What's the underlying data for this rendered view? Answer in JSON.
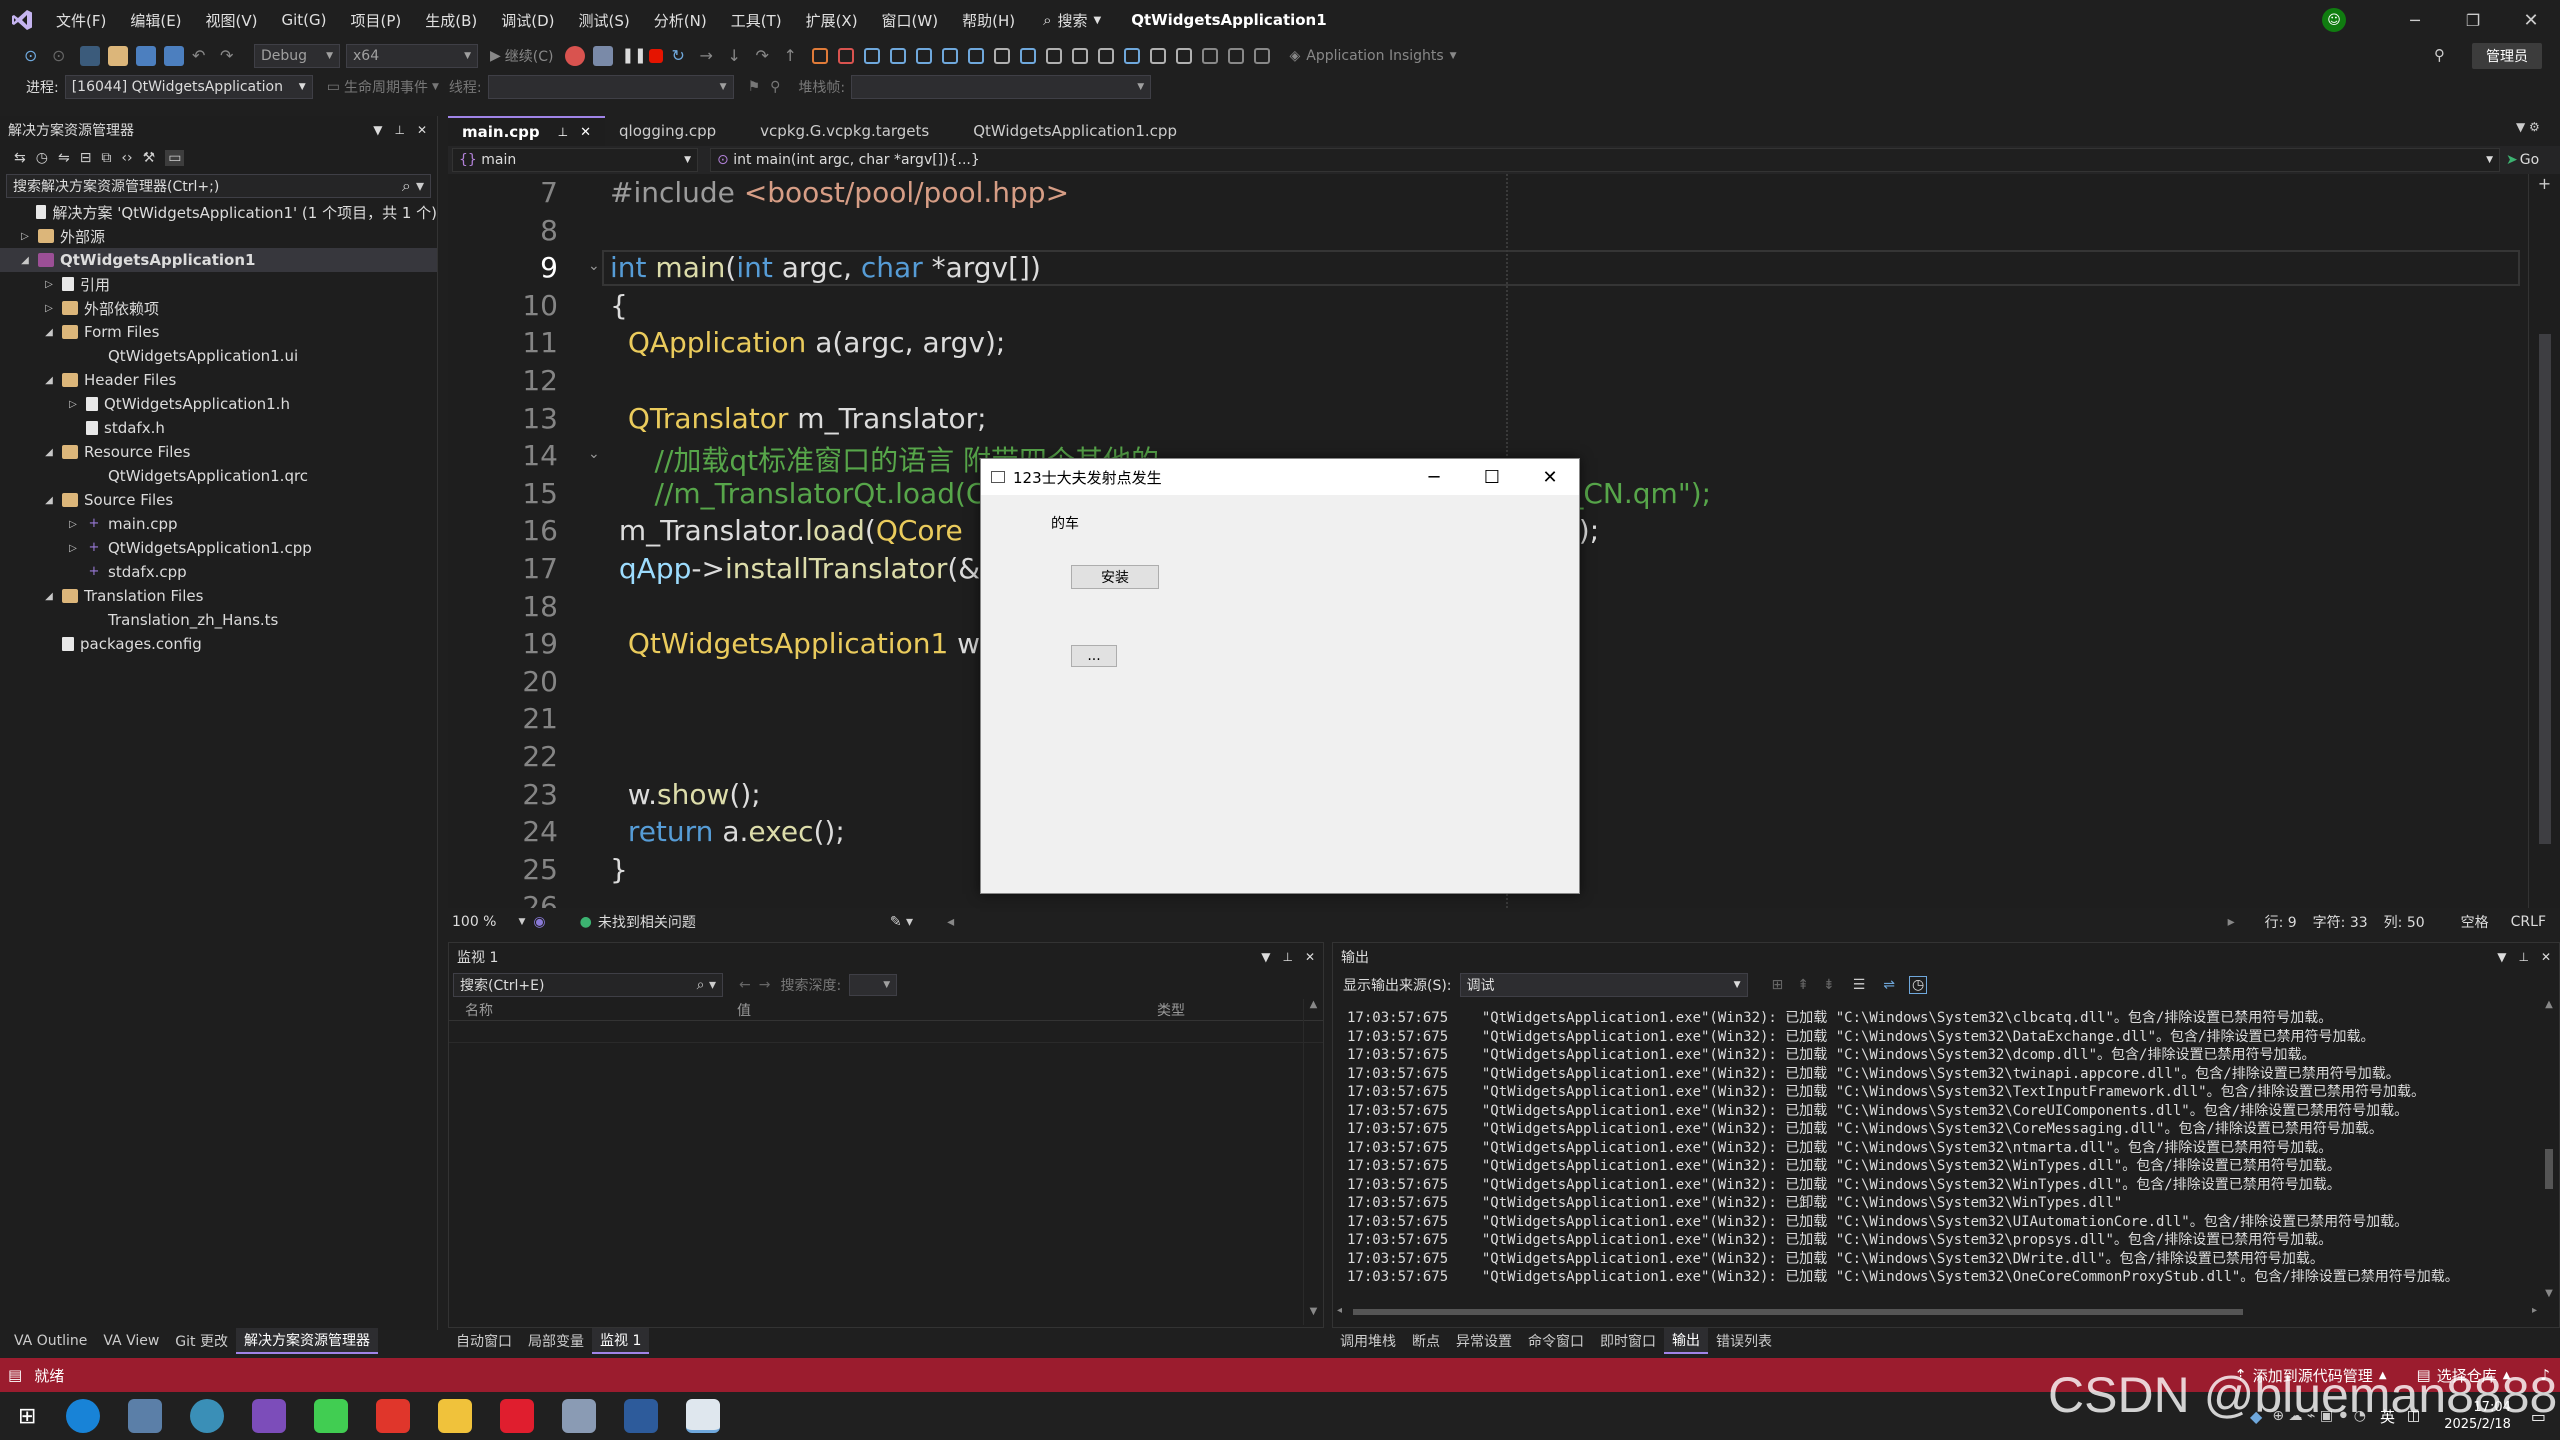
{
  "titlebar": {
    "menus": [
      "文件(F)",
      "编辑(E)",
      "视图(V)",
      "Git(G)",
      "项目(P)",
      "生成(B)",
      "调试(D)",
      "测试(S)",
      "分析(N)",
      "工具(T)",
      "扩展(X)",
      "窗口(W)",
      "帮助(H)"
    ],
    "search_label": "搜索",
    "app_title": "QtWidgetsApplication1",
    "admin_label": "管理员"
  },
  "toolbar": {
    "config": "Debug",
    "platform": "x64",
    "continue_label": "继续(C)",
    "app_insights": "Application Insights"
  },
  "toolbar2": {
    "process_label": "进程:",
    "process_value": "[16044] QtWidgetsApplication",
    "lifecycle_label": "生命周期事件",
    "thread_label": "线程:",
    "stackframe_label": "堆栈帧:"
  },
  "solution": {
    "title": "解决方案资源管理器",
    "search_placeholder": "搜索解决方案资源管理器(Ctrl+;)",
    "items": [
      {
        "label": "解决方案 'QtWidgetsApplication1' (1 个项目，共 1 个)",
        "indent": 0,
        "icon": "doc",
        "tw": ""
      },
      {
        "label": "外部源",
        "indent": 0,
        "icon": "folder",
        "tw": "▷"
      },
      {
        "label": "QtWidgetsApplication1",
        "indent": 0,
        "icon": "proj",
        "tw": "◢",
        "sel": true
      },
      {
        "label": "引用",
        "indent": 1,
        "icon": "doc",
        "tw": "▷"
      },
      {
        "label": "外部依赖项",
        "indent": 1,
        "icon": "folder",
        "tw": "▷"
      },
      {
        "label": "Form Files",
        "indent": 1,
        "icon": "folder",
        "tw": "◢"
      },
      {
        "label": "QtWidgetsApplication1.ui",
        "indent": 2,
        "icon": "none",
        "tw": ""
      },
      {
        "label": "Header Files",
        "indent": 1,
        "icon": "folder",
        "tw": "◢"
      },
      {
        "label": "QtWidgetsApplication1.h",
        "indent": 2,
        "icon": "doc",
        "tw": "▷"
      },
      {
        "label": "stdafx.h",
        "indent": 2,
        "icon": "doc",
        "tw": ""
      },
      {
        "label": "Resource Files",
        "indent": 1,
        "icon": "folder",
        "tw": "◢"
      },
      {
        "label": "QtWidgetsApplication1.qrc",
        "indent": 2,
        "icon": "none",
        "tw": ""
      },
      {
        "label": "Source Files",
        "indent": 1,
        "icon": "folder",
        "tw": "◢"
      },
      {
        "label": "main.cpp",
        "indent": 2,
        "icon": "cpp",
        "tw": "▷"
      },
      {
        "label": "QtWidgetsApplication1.cpp",
        "indent": 2,
        "icon": "cpp",
        "tw": "▷"
      },
      {
        "label": "stdafx.cpp",
        "indent": 2,
        "icon": "cpp",
        "tw": ""
      },
      {
        "label": "Translation Files",
        "indent": 1,
        "icon": "folder",
        "tw": "◢"
      },
      {
        "label": "Translation_zh_Hans.ts",
        "indent": 2,
        "icon": "none",
        "tw": ""
      },
      {
        "label": "packages.config",
        "indent": 1,
        "icon": "doc",
        "tw": ""
      }
    ]
  },
  "editor_tabs": [
    "main.cpp",
    "qlogging.cpp",
    "vcpkg.G.vcpkg.targets",
    "QtWidgetsApplication1.cpp"
  ],
  "navbar": {
    "scope": "main",
    "member": "int main(int argc, char *argv[]){...}",
    "go": "Go"
  },
  "code_lines": [
    {
      "n": "7",
      "html": "<span class='pp'>#include </span><span class='str'>&lt;boost/pool/pool.hpp&gt;</span>"
    },
    {
      "n": "8",
      "html": ""
    },
    {
      "n": "9",
      "html": "<span class='kw'>int</span> <span class='fn'>main</span>(<span class='kw'>int</span> argc, <span class='kw'>char</span> *argv[])"
    },
    {
      "n": "10",
      "html": "{"
    },
    {
      "n": "11",
      "html": "  <span class='cls'>QApplication</span> a(argc, argv);"
    },
    {
      "n": "12",
      "html": ""
    },
    {
      "n": "13",
      "html": "  <span class='cls'>QTranslator</span> m_Translator;"
    },
    {
      "n": "14",
      "html": "     <span class='cm'>//加载qt标准窗口的语言 附带四个其他的</span>"
    },
    {
      "n": "15",
      "html": "     <span class='cm'>//m_TranslatorQt.load(C                                          nslations/qt_zh_CN.qm\");</span>"
    },
    {
      "n": "16",
      "html": " m_Translator.<span class='fn'>load</span>(<span class='cls'>QCore</span>                                             <span class='str'>n_zh_Hans.qm\"</span>);"
    },
    {
      "n": "17",
      "html": " <span class='var'>qApp</span>-&gt;<span class='fn'>installTranslator</span>(&amp;"
    },
    {
      "n": "18",
      "html": ""
    },
    {
      "n": "19",
      "html": "  <span class='cls'>QtWidgetsApplication1</span> w"
    },
    {
      "n": "20",
      "html": ""
    },
    {
      "n": "21",
      "html": ""
    },
    {
      "n": "22",
      "html": ""
    },
    {
      "n": "23",
      "html": "  w.<span class='fn'>show</span>();"
    },
    {
      "n": "24",
      "html": "  <span class='kw'>return</span> a.<span class='fn'>exec</span>();"
    },
    {
      "n": "25",
      "html": "}"
    },
    {
      "n": "26",
      "html": ""
    }
  ],
  "statusline": {
    "zoom": "100 %",
    "issues": "未找到相关问题",
    "line": "行: 9",
    "char": "字符: 33",
    "col": "列: 50",
    "space": "空格",
    "eol": "CRLF"
  },
  "watch": {
    "title": "监视 1",
    "search_placeholder": "搜索(Ctrl+E)",
    "depth_label": "搜索深度:",
    "col_name": "名称",
    "col_value": "值",
    "col_type": "类型"
  },
  "output": {
    "title": "输出",
    "source_label": "显示输出来源(S):",
    "source_value": "调试",
    "lines": [
      "17:03:57:675    \"QtWidgetsApplication1.exe\"(Win32): 已加载 \"C:\\Windows\\System32\\clbcatq.dll\"。包含/排除设置已禁用符号加载。",
      "17:03:57:675    \"QtWidgetsApplication1.exe\"(Win32): 已加载 \"C:\\Windows\\System32\\DataExchange.dll\"。包含/排除设置已禁用符号加载。",
      "17:03:57:675    \"QtWidgetsApplication1.exe\"(Win32): 已加载 \"C:\\Windows\\System32\\dcomp.dll\"。包含/排除设置已禁用符号加载。",
      "17:03:57:675    \"QtWidgetsApplication1.exe\"(Win32): 已加载 \"C:\\Windows\\System32\\twinapi.appcore.dll\"。包含/排除设置已禁用符号加载。",
      "17:03:57:675    \"QtWidgetsApplication1.exe\"(Win32): 已加载 \"C:\\Windows\\System32\\TextInputFramework.dll\"。包含/排除设置已禁用符号加载。",
      "17:03:57:675    \"QtWidgetsApplication1.exe\"(Win32): 已加载 \"C:\\Windows\\System32\\CoreUIComponents.dll\"。包含/排除设置已禁用符号加载。",
      "17:03:57:675    \"QtWidgetsApplication1.exe\"(Win32): 已加载 \"C:\\Windows\\System32\\CoreMessaging.dll\"。包含/排除设置已禁用符号加载。",
      "17:03:57:675    \"QtWidgetsApplication1.exe\"(Win32): 已加载 \"C:\\Windows\\System32\\ntmarta.dll\"。包含/排除设置已禁用符号加载。",
      "17:03:57:675    \"QtWidgetsApplication1.exe\"(Win32): 已加载 \"C:\\Windows\\System32\\WinTypes.dll\"。包含/排除设置已禁用符号加载。",
      "17:03:57:675    \"QtWidgetsApplication1.exe\"(Win32): 已加载 \"C:\\Windows\\System32\\WinTypes.dll\"。包含/排除设置已禁用符号加载。",
      "17:03:57:675    \"QtWidgetsApplication1.exe\"(Win32): 已卸载 \"C:\\Windows\\System32\\WinTypes.dll\"",
      "17:03:57:675    \"QtWidgetsApplication1.exe\"(Win32): 已加载 \"C:\\Windows\\System32\\UIAutomationCore.dll\"。包含/排除设置已禁用符号加载。",
      "17:03:57:675    \"QtWidgetsApplication1.exe\"(Win32): 已加载 \"C:\\Windows\\System32\\propsys.dll\"。包含/排除设置已禁用符号加载。",
      "17:03:57:675    \"QtWidgetsApplication1.exe\"(Win32): 已加载 \"C:\\Windows\\System32\\DWrite.dll\"。包含/排除设置已禁用符号加载。",
      "17:03:57:675    \"QtWidgetsApplication1.exe\"(Win32): 已加载 \"C:\\Windows\\System32\\OneCoreCommonProxyStub.dll\"。包含/排除设置已禁用符号加载。"
    ]
  },
  "left_bottom_tabs": [
    "VA Outline",
    "VA View",
    "Git 更改",
    "解决方案资源管理器"
  ],
  "mid_bottom_tabs": [
    "自动窗口",
    "局部变量",
    "监视 1"
  ],
  "right_bottom_tabs": [
    "调用堆栈",
    "断点",
    "异常设置",
    "命令窗口",
    "即时窗口",
    "输出",
    "错误列表"
  ],
  "statusbar": {
    "ready": "就绪",
    "add_source": "添加到源代码管理",
    "select_repo": "选择仓库"
  },
  "taskbar": {
    "time": "17:04",
    "date": "2025/2/18",
    "ime": "英"
  },
  "watermark": "CSDN @blueman8888",
  "dialog": {
    "title": "123士大夫发射点发生",
    "label": "的车",
    "install_button": "安装",
    "dots_button": "..."
  },
  "colors": {
    "accent": "#a084e8",
    "statusbar": "#9b1c2e",
    "editor_bg": "#1e1e1e"
  }
}
